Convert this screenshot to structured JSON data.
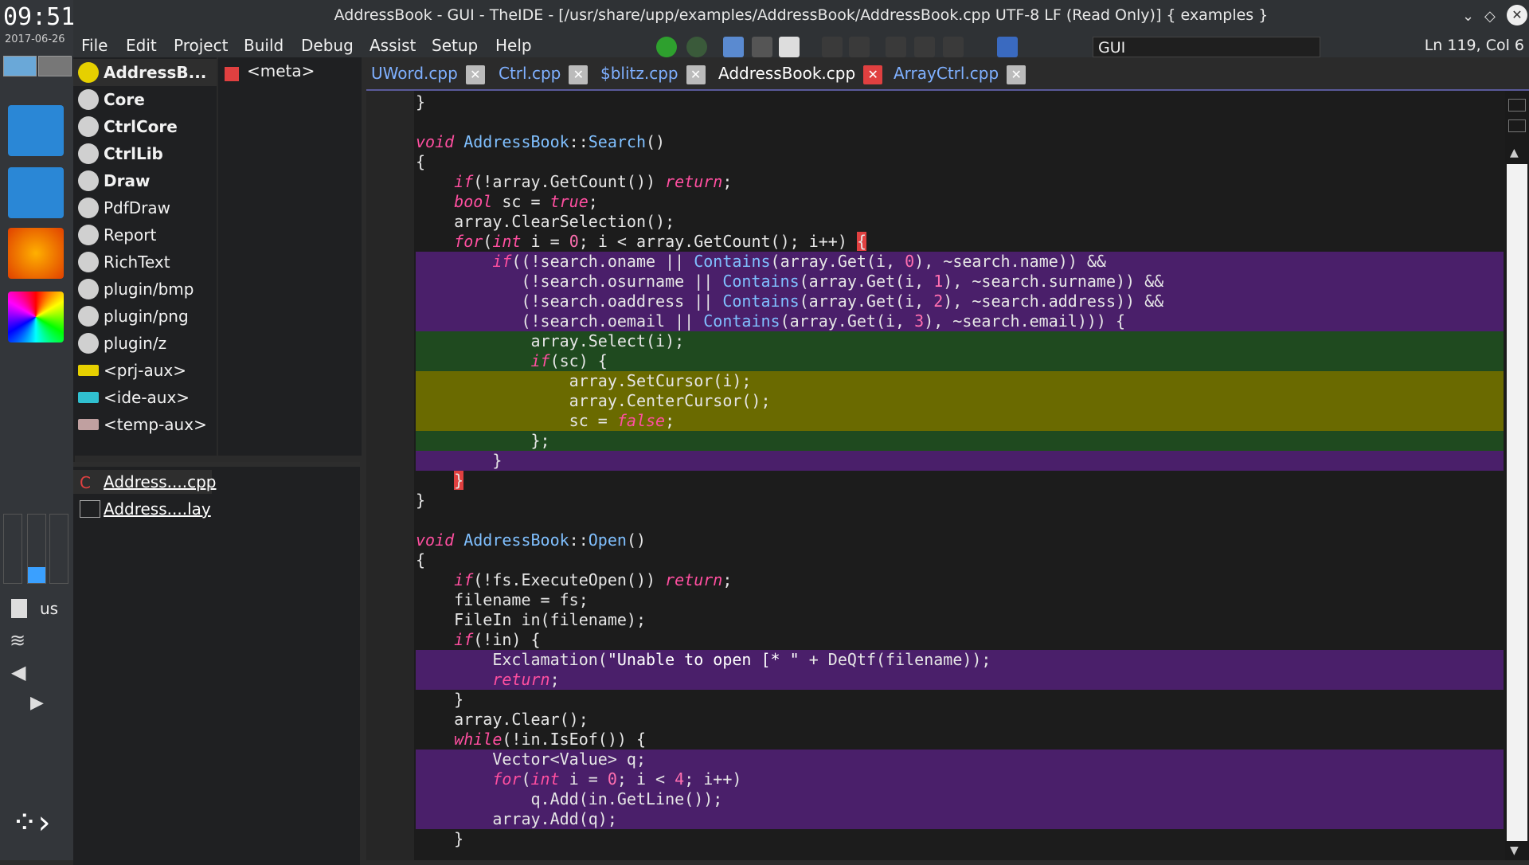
{
  "clock": {
    "time": "09:51",
    "date": "2017-06-26"
  },
  "titlebar": {
    "title": "AddressBook - GUI - TheIDE - [/usr/share/upp/examples/AddressBook/AddressBook.cpp UTF-8 LF (Read Only)] { examples }"
  },
  "menu": [
    "File",
    "Edit",
    "Project",
    "Build",
    "Debug",
    "Assist",
    "Setup",
    "Help"
  ],
  "toolbar": {
    "search_value": "GUI",
    "cursor_pos": "Ln 119, Col 6"
  },
  "packages": [
    "AddressB...",
    "Core",
    "CtrlCore",
    "CtrlLib",
    "Draw",
    "PdfDraw",
    "Report",
    "RichText",
    "plugin/bmp",
    "plugin/png",
    "plugin/z",
    "<prj-aux>",
    "<ide-aux>",
    "<temp-aux>"
  ],
  "files_panel": [
    "<meta>"
  ],
  "lower_files": [
    "Address....cpp",
    "Address....lay"
  ],
  "tray": {
    "kbd_layout": "us"
  },
  "tabs": [
    {
      "label": "UWord.cpp",
      "active": false
    },
    {
      "label": "Ctrl.cpp",
      "active": false
    },
    {
      "label": "$blitz.cpp",
      "active": false
    },
    {
      "label": "AddressBook.cpp",
      "active": true
    },
    {
      "label": "ArrayCtrl.cpp",
      "active": false
    }
  ],
  "colors": {
    "bg": "#1c1c1c",
    "keyword": "#ff4fa0",
    "function": "#80c0ff"
  }
}
